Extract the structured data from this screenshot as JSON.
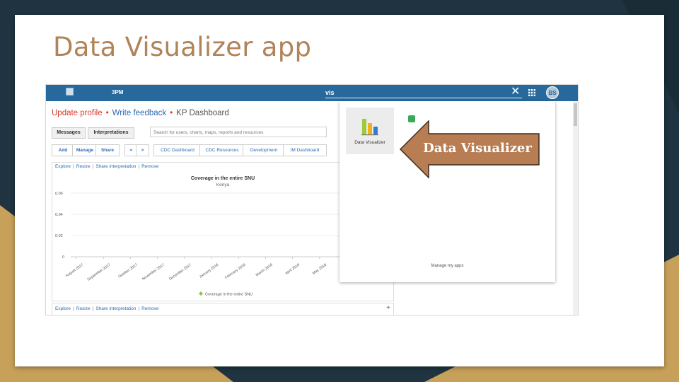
{
  "slide": {
    "title": "Data Visualizer app"
  },
  "header": {
    "org": "3PM",
    "search_query": "vis",
    "close": "✕",
    "avatar": "BS"
  },
  "links": {
    "update_profile": "Update profile",
    "write_feedback": "Write feedback",
    "dashboard": "KP Dashboard",
    "sep": "•"
  },
  "toolbar": {
    "messages": "Messages",
    "interpretations": "Interpretations",
    "search_placeholder": "Search for users, charts, maps, reports and resources"
  },
  "dashbar": {
    "add": "Add",
    "manage": "Manage",
    "share": "Share",
    "prev": "<",
    "next": ">",
    "dashboards": [
      "CDC Dashboard",
      "CDC Resources",
      "Development",
      "IM Dashboard"
    ]
  },
  "item_actions": {
    "explore": "Explore",
    "resize": "Resize",
    "share": "Share interpretation",
    "remove": "Remove",
    "sep": "|",
    "plus": "+"
  },
  "apps_menu": {
    "app_label": "Data Visualizer",
    "manage": "Manage my apps"
  },
  "callout": {
    "label": "Data Visualizer",
    "color": "#b97d54"
  },
  "chart_data": {
    "type": "line",
    "title": "Coverage in the entire SNU",
    "subtitle": "Kenya",
    "categories": [
      "August 2017",
      "September 2017",
      "October 2017",
      "November 2017",
      "December 2017",
      "January 2018",
      "February 2018",
      "March 2018",
      "April 2018",
      "May 2018"
    ],
    "yticks": [
      "0.06",
      "0.04",
      "0.02",
      "0"
    ],
    "ylim": [
      0,
      0.06
    ],
    "series": [
      {
        "name": "Coverage in the entire SNU",
        "values": []
      }
    ],
    "legend_color": "#8cc63f",
    "grid": true
  }
}
